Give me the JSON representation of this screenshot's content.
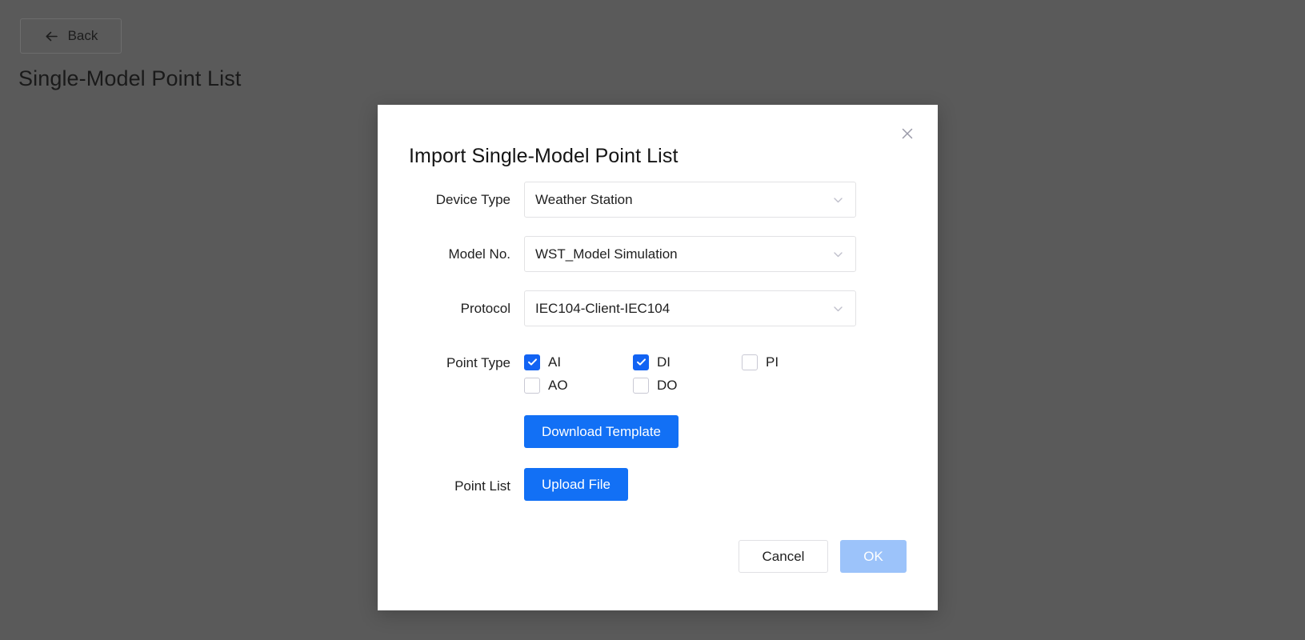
{
  "page": {
    "back_label": "Back",
    "back_icon": "arrow-left-icon",
    "title": "Single-Model Point List",
    "background_color": "#5a5a5a"
  },
  "dialog": {
    "title": "Import Single-Model Point List",
    "close_icon": "close-icon",
    "accent_color": "#1270f5",
    "fields": [
      {
        "label": "Device Type",
        "value": "Weather Station",
        "icon": "chevron-down-icon",
        "name": "device-type-select"
      },
      {
        "label": "Model No.",
        "value": "WST_Model Simulation",
        "icon": "chevron-down-icon",
        "name": "model-no-select"
      },
      {
        "label": "Protocol",
        "value": "IEC104-Client-IEC104",
        "icon": "chevron-down-icon",
        "name": "protocol-select"
      }
    ],
    "point_type": {
      "label": "Point Type",
      "options": [
        {
          "label": "AI",
          "checked": true
        },
        {
          "label": "DI",
          "checked": true
        },
        {
          "label": "PI",
          "checked": false
        },
        {
          "label": "AO",
          "checked": false
        },
        {
          "label": "DO",
          "checked": false
        }
      ]
    },
    "download_template_label": "Download Template",
    "point_list": {
      "label": "Point List",
      "upload_label": "Upload File"
    },
    "footer": {
      "cancel_label": "Cancel",
      "ok_label": "OK",
      "ok_disabled": true
    }
  }
}
